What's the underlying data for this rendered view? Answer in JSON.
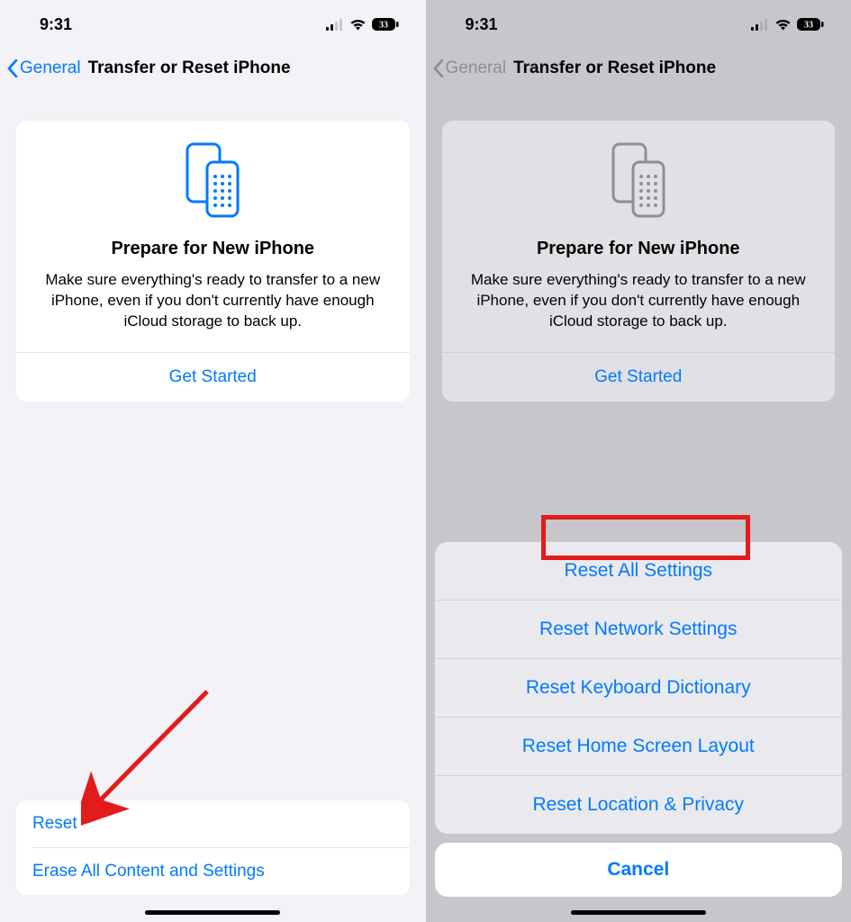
{
  "status": {
    "time": "9:31",
    "battery_percent": "33"
  },
  "nav": {
    "back_label": "General",
    "title": "Transfer or Reset iPhone"
  },
  "prepare_card": {
    "title": "Prepare for New iPhone",
    "body": "Make sure everything's ready to transfer to a new iPhone, even if you don't currently have enough iCloud storage to back up.",
    "action": "Get Started"
  },
  "bottom_list": {
    "reset": "Reset",
    "erase": "Erase All Content and Settings"
  },
  "action_sheet": {
    "items": [
      "Reset All Settings",
      "Reset Network Settings",
      "Reset Keyboard Dictionary",
      "Reset Home Screen Layout",
      "Reset Location & Privacy"
    ],
    "cancel": "Cancel"
  },
  "annotations": {
    "arrow_target": "reset-row",
    "highlight_target": "reset-all-settings"
  }
}
